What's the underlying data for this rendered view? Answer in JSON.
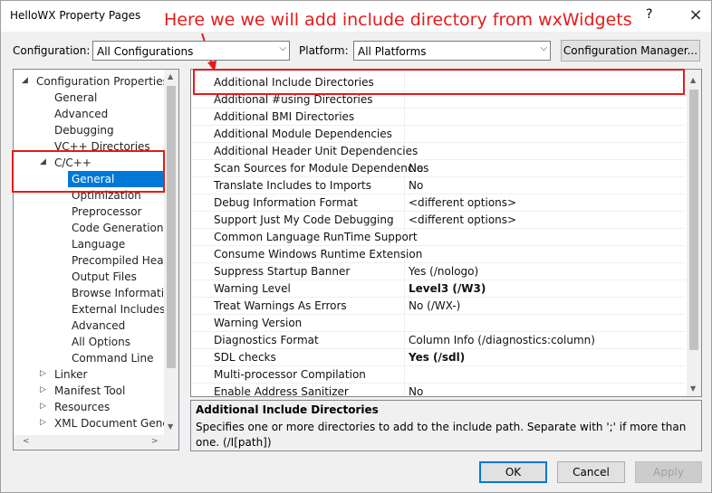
{
  "window": {
    "title": "HelloWX Property Pages",
    "help_icon": "?",
    "close_icon": "×"
  },
  "annotation": {
    "text": "Here we we will add include directory from wxWidgets",
    "color": "#e51b1b"
  },
  "toolbar": {
    "configuration_label": "Configuration:",
    "configuration_value": "All Configurations",
    "platform_label": "Platform:",
    "platform_value": "All Platforms",
    "config_manager_label": "Configuration Manager..."
  },
  "tree": {
    "items": [
      {
        "label": "Configuration Properties",
        "expanded": true
      },
      {
        "label": "General"
      },
      {
        "label": "Advanced"
      },
      {
        "label": "Debugging"
      },
      {
        "label": "VC++ Directories"
      },
      {
        "label": "C/C++",
        "expanded": true
      },
      {
        "label": "General",
        "selected": true
      },
      {
        "label": "Optimization"
      },
      {
        "label": "Preprocessor"
      },
      {
        "label": "Code Generation"
      },
      {
        "label": "Language"
      },
      {
        "label": "Precompiled Heade"
      },
      {
        "label": "Output Files"
      },
      {
        "label": "Browse Information"
      },
      {
        "label": "External Includes"
      },
      {
        "label": "Advanced"
      },
      {
        "label": "All Options"
      },
      {
        "label": "Command Line"
      },
      {
        "label": "Linker"
      },
      {
        "label": "Manifest Tool"
      },
      {
        "label": "Resources"
      },
      {
        "label": "XML Document Genera"
      }
    ]
  },
  "properties": [
    {
      "name": "Additional Include Directories",
      "value": ""
    },
    {
      "name": "Additional #using Directories",
      "value": ""
    },
    {
      "name": "Additional BMI Directories",
      "value": ""
    },
    {
      "name": "Additional Module Dependencies",
      "value": ""
    },
    {
      "name": "Additional Header Unit Dependencies",
      "value": ""
    },
    {
      "name": "Scan Sources for Module Dependencies",
      "value": "No"
    },
    {
      "name": "Translate Includes to Imports",
      "value": "No"
    },
    {
      "name": "Debug Information Format",
      "value": "<different options>"
    },
    {
      "name": "Support Just My Code Debugging",
      "value": "<different options>"
    },
    {
      "name": "Common Language RunTime Support",
      "value": ""
    },
    {
      "name": "Consume Windows Runtime Extension",
      "value": ""
    },
    {
      "name": "Suppress Startup Banner",
      "value": "Yes (/nologo)"
    },
    {
      "name": "Warning Level",
      "value": "Level3 (/W3)",
      "bold": true
    },
    {
      "name": "Treat Warnings As Errors",
      "value": "No (/WX-)"
    },
    {
      "name": "Warning Version",
      "value": ""
    },
    {
      "name": "Diagnostics Format",
      "value": "Column Info (/diagnostics:column)"
    },
    {
      "name": "SDL checks",
      "value": "Yes (/sdl)",
      "bold": true
    },
    {
      "name": "Multi-processor Compilation",
      "value": ""
    },
    {
      "name": "Enable Address Sanitizer",
      "value": "No"
    }
  ],
  "description": {
    "title": "Additional Include Directories",
    "text": "Specifies one or more directories to add to the include path. Separate with ';' if more than one. (/I[path])"
  },
  "buttons": {
    "ok": "OK",
    "cancel": "Cancel",
    "apply": "Apply"
  }
}
